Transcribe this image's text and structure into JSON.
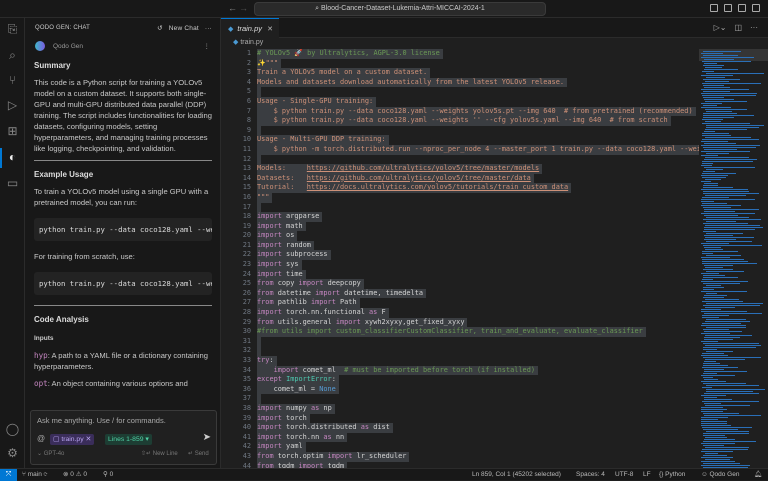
{
  "titlebar": {
    "search": "Blood-Cancer-Dataset-Lukemia-Attri-MICCAI-2024-1",
    "back": "←",
    "forward": "→"
  },
  "sidebar": {
    "header": "QODO GEN: CHAT",
    "new_chat": "New Chat",
    "more": "···",
    "bot_name": "Qodo Gen",
    "bot_more": "⋮",
    "summary_title": "Summary",
    "summary_text": "This code is a Python script for training a YOLOv5 model on a custom dataset. It supports both single-GPU and multi-GPU distributed data parallel (DDP) training. The script includes functionalities for loading datasets, configuring models, setting hyperparameters, and managing training processes like logging, checkpointing, and validation.",
    "example_title": "Example Usage",
    "example_text1": "To train a YOLOv5 model using a single GPU with a pretrained model, you can run:",
    "code1": "python train.py --data coco128.yaml --weights yolov5s.pt --img 640",
    "example_text2": "For training from scratch, use:",
    "code2": "python train.py --data coco128.yaml --weights '' --cfg yolov5s.yaml --img 640",
    "analysis_title": "Code Analysis",
    "inputs_title": "Inputs",
    "inputs": [
      {
        "name": "hyp",
        "desc": ": A path to a YAML file or a dictionary containing hyperparameters."
      },
      {
        "name": "opt",
        "desc": ": An object containing various options and"
      }
    ],
    "input_placeholder": "Ask me anything. Use / for commands.",
    "at": "@",
    "file_chip": "train.py",
    "lines_chip": "Lines 1-859",
    "model": "GPT-4o",
    "new_line": "New Line",
    "send": "Send"
  },
  "editor": {
    "tab": "train.py",
    "breadcrumb": "train.py",
    "lines": [
      [
        [
          "# YOLOv5 🚀 by Ultralytics, AGPL-3.0 license",
          "com"
        ]
      ],
      [
        [
          "✨\"\"\"",
          "str"
        ]
      ],
      [
        [
          "Train a YOLOv5 model on a custom dataset.",
          "str"
        ]
      ],
      [
        [
          "Models and datasets download automatically from the latest YOLOv5 release.",
          "str"
        ]
      ],
      [],
      [
        [
          "Usage - Single-GPU training:",
          "str"
        ]
      ],
      [
        [
          "    $ python train.py --data coco128.yaml --weights yolov5s.pt --img 640  # from pretrained (recommended)",
          "str"
        ]
      ],
      [
        [
          "    $ python train.py --data coco128.yaml --weights '' --cfg yolov5s.yaml --img 640  # from scratch",
          "str"
        ]
      ],
      [],
      [
        [
          "Usage - Multi-GPU DDP training:",
          "str"
        ]
      ],
      [
        [
          "    $ python -m torch.distributed.run --nproc_per_node 4 --master_port 1 train.py --data coco128.yaml --weights yolov5s.pt",
          "str"
        ]
      ],
      [],
      [
        [
          "Models:     ",
          "str"
        ],
        [
          "https://github.com/ultralytics/yolov5/tree/master/models",
          "url"
        ]
      ],
      [
        [
          "Datasets:   ",
          "str"
        ],
        [
          "https://github.com/ultralytics/yolov5/tree/master/data",
          "url"
        ]
      ],
      [
        [
          "Tutorial:   ",
          "str"
        ],
        [
          "https://docs.ultralytics.com/yolov5/tutorials/train_custom_data",
          "url"
        ]
      ],
      [
        [
          "\"\"\"",
          "str"
        ]
      ],
      [],
      [
        [
          "import",
          "kw"
        ],
        [
          " argparse",
          "def"
        ]
      ],
      [
        [
          "import",
          "kw"
        ],
        [
          " math",
          "def"
        ]
      ],
      [
        [
          "import",
          "kw"
        ],
        [
          " os",
          "def"
        ]
      ],
      [
        [
          "import",
          "kw"
        ],
        [
          " random",
          "def"
        ]
      ],
      [
        [
          "import",
          "kw"
        ],
        [
          " subprocess",
          "def"
        ]
      ],
      [
        [
          "import",
          "kw"
        ],
        [
          " sys",
          "def"
        ]
      ],
      [
        [
          "import",
          "kw"
        ],
        [
          " time",
          "def"
        ]
      ],
      [
        [
          "from",
          "kw"
        ],
        [
          " copy ",
          "def"
        ],
        [
          "import",
          "kw"
        ],
        [
          " deepcopy",
          "def"
        ]
      ],
      [
        [
          "from",
          "kw"
        ],
        [
          " datetime ",
          "def"
        ],
        [
          "import",
          "kw"
        ],
        [
          " datetime, timedelta",
          "def"
        ]
      ],
      [
        [
          "from",
          "kw"
        ],
        [
          " pathlib ",
          "def"
        ],
        [
          "import",
          "kw"
        ],
        [
          " Path",
          "def"
        ]
      ],
      [
        [
          "import",
          "kw"
        ],
        [
          " torch.nn.functional ",
          "def"
        ],
        [
          "as",
          "kw"
        ],
        [
          " F",
          "def"
        ]
      ],
      [
        [
          "from",
          "kw"
        ],
        [
          " utils.general ",
          "def"
        ],
        [
          "import",
          "kw"
        ],
        [
          " xywh2xyxy,get_fixed_xyxy",
          "def"
        ]
      ],
      [
        [
          "#from utils import custom_classifierCustomClassifier, train_and_evaluate, evaluate_classifier",
          "com"
        ]
      ],
      [],
      [],
      [
        [
          "try",
          "kw"
        ],
        [
          ":",
          "def"
        ]
      ],
      [
        [
          "    ",
          "def"
        ],
        [
          "import",
          "kw"
        ],
        [
          " comet_ml  ",
          "def"
        ],
        [
          "# must be imported before torch (if installed)",
          "com"
        ]
      ],
      [
        [
          "except",
          "kw"
        ],
        [
          " ",
          "def"
        ],
        [
          "ImportError",
          "cls"
        ],
        [
          ":",
          "def"
        ]
      ],
      [
        [
          "    comet_ml = ",
          "def"
        ],
        [
          "None",
          "const"
        ]
      ],
      [],
      [
        [
          "import",
          "kw"
        ],
        [
          " numpy ",
          "def"
        ],
        [
          "as",
          "kw"
        ],
        [
          " np",
          "def"
        ]
      ],
      [
        [
          "import",
          "kw"
        ],
        [
          " torch",
          "def"
        ]
      ],
      [
        [
          "import",
          "kw"
        ],
        [
          " torch.distributed ",
          "def"
        ],
        [
          "as",
          "kw"
        ],
        [
          " dist",
          "def"
        ]
      ],
      [
        [
          "import",
          "kw"
        ],
        [
          " torch.nn ",
          "def"
        ],
        [
          "as",
          "kw"
        ],
        [
          " nn",
          "def"
        ]
      ],
      [
        [
          "import",
          "kw"
        ],
        [
          " yaml",
          "def"
        ]
      ],
      [
        [
          "from",
          "kw"
        ],
        [
          " torch.optim ",
          "def"
        ],
        [
          "import",
          "kw"
        ],
        [
          " lr_scheduler",
          "def"
        ]
      ],
      [
        [
          "from",
          "kw"
        ],
        [
          " tqdm ",
          "def"
        ],
        [
          "import",
          "kw"
        ],
        [
          " tqdm",
          "def"
        ]
      ]
    ]
  },
  "status": {
    "branch": "main",
    "errors": "0",
    "warnings": "0",
    "ports": "0",
    "cursor": "Ln 859, Col 1 (45202 selected)",
    "spaces": "Spaces: 4",
    "encoding": "UTF-8",
    "eol": "LF",
    "language": "Python",
    "qodo": "Qodo Gen"
  },
  "colors": {
    "accent": "#0078d4",
    "minimap": "#2a6fb7",
    "selection": "#3a3d41"
  }
}
